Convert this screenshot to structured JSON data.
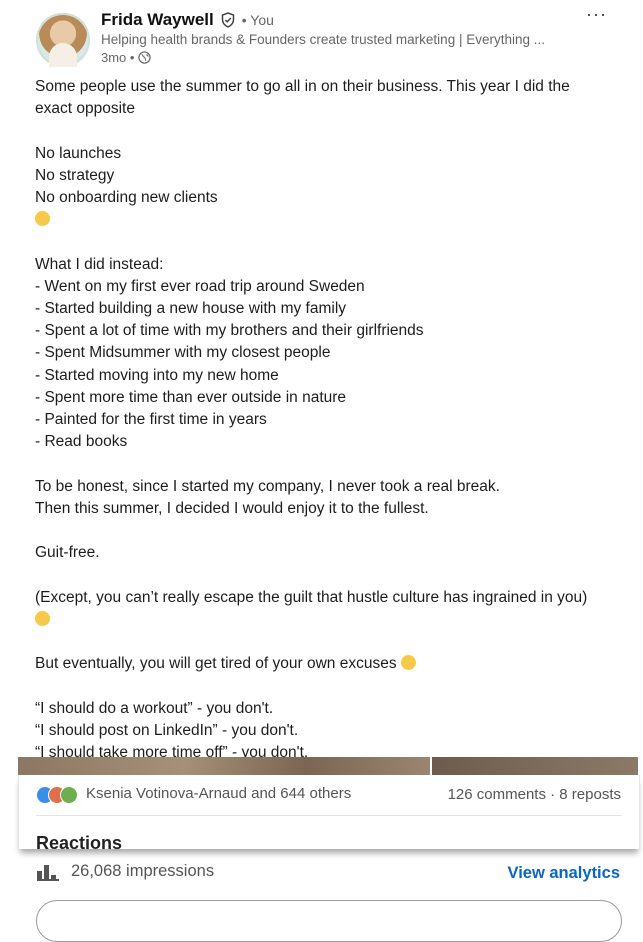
{
  "author": {
    "name": "Frida Waywell",
    "you_label": "• You",
    "headline": "Helping health brands & Founders create trusted marketing | Everything ...",
    "time": "3mo •"
  },
  "post": {
    "lines": [
      "Some people use the summer to go all in on their business. This year I did the",
      "exact opposite",
      "",
      "No launches",
      "No strategy",
      "No onboarding new clients",
      "",
      "What I did instead:",
      "- Went on my first ever road trip around Sweden",
      "- Started building a new house with my family",
      "- Spent a lot of time with my brothers and their girlfriends",
      "- Spent Midsummer with my closest people",
      "- Started moving into my new home",
      "- Spent more time than ever outside in nature",
      "- Painted for the first time in years",
      "- Read books",
      "",
      "To be honest, since I started my company, I never took a real break.",
      "Then this summer, I decided I would enjoy it to the fullest.",
      "",
      "Guit-free.",
      "",
      "(Except, you can’t really escape the guilt that hustle culture has ingrained in you)",
      "",
      "But eventually, you will get tired of your own excuses",
      "",
      "“I should do a workout” - you don't.",
      "“I should post on LinkedIn” - you don't.",
      "“I should take more time off” - you don't."
    ]
  },
  "social": {
    "reactors": "Ksenia Votinova-Arnaud and 644 others",
    "comments_reposts": "126 comments · 8 reposts",
    "reactions_title": "Reactions"
  },
  "analytics": {
    "impressions": "26,068 impressions",
    "view_label": "View analytics"
  },
  "icons": {
    "verified": "verified-shield-icon",
    "globe": "globe-icon",
    "more": "more-options-icon",
    "impressions": "bar-chart-icon"
  },
  "colors": {
    "link": "#0a66c2",
    "text": "#1d1d1f",
    "muted": "#666666"
  }
}
